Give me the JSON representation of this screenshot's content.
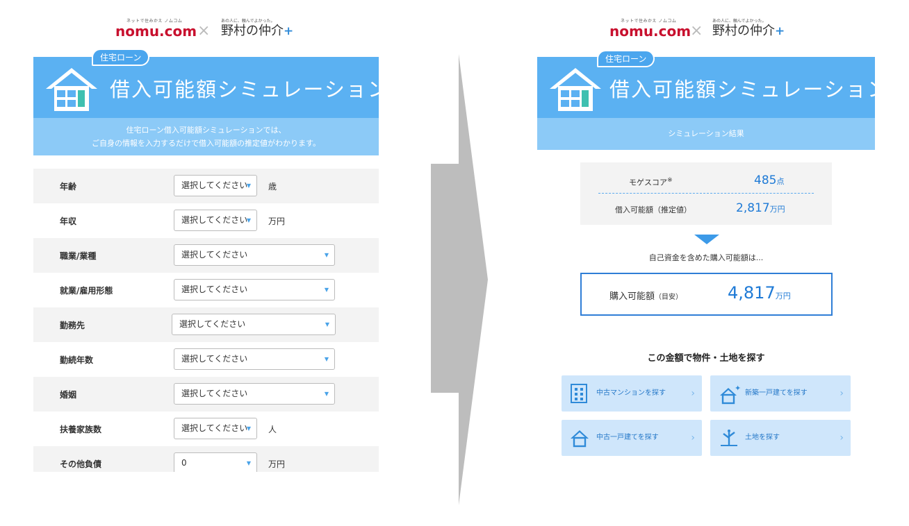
{
  "logos": {
    "nomu_tagline": "ネットで住みかえ ノムコム",
    "nomu_brand": "nomu.com",
    "separator": "×",
    "nakai_tagline": "あの人に、頼んでよかった。",
    "nakai_brand": "野村の仲介",
    "nakai_plus": "+"
  },
  "badge": "住宅ローン",
  "title": "借入可能額シミュレーション",
  "form_screen": {
    "intro_line1": "住宅ローン借入可能額シミュレーションでは、",
    "intro_line2": "ご自身の情報を入力するだけで借入可能額の推定値がわかります。",
    "rows": [
      {
        "label": "年齢",
        "value": "選択してください",
        "unit": "歳"
      },
      {
        "label": "年収",
        "value": "選択してください",
        "unit": "万円"
      },
      {
        "label": "職業/業種",
        "value": "選択してください",
        "unit": ""
      },
      {
        "label": "就業/雇用形態",
        "value": "選択してください",
        "unit": ""
      },
      {
        "label": "勤務先",
        "value": "選択してください",
        "unit": ""
      },
      {
        "label": "勤続年数",
        "value": "選択してください",
        "unit": ""
      },
      {
        "label": "婚姻",
        "value": "選択してください",
        "unit": ""
      },
      {
        "label": "扶養家族数",
        "value": "選択してください",
        "unit": "人"
      },
      {
        "label": "その他負債",
        "value": "0",
        "unit": "万円"
      }
    ]
  },
  "result_screen": {
    "subheading": "シミュレーション結果",
    "moge_label": "モゲスコア",
    "moge_mark": "※",
    "moge_value": "485",
    "moge_unit": "点",
    "loan_label": "借入可能額（推定値）",
    "loan_value": "2,817",
    "loan_unit": "万円",
    "caption": "自己資金を含めた購入可能額は...",
    "purchase_label": "購入可能額",
    "purchase_sub": "（目安）",
    "purchase_value": "4,817",
    "purchase_unit": "万円",
    "search_title": "この金額で物件・土地を探す",
    "buttons": [
      {
        "label": "中古マンションを探す",
        "icon": "building-icon"
      },
      {
        "label": "新築一戸建てを探す",
        "icon": "new-house-icon"
      },
      {
        "label": "中古一戸建てを探す",
        "icon": "house-icon"
      },
      {
        "label": "土地を探す",
        "icon": "sprout-icon"
      }
    ],
    "chevron": "›"
  },
  "colors": {
    "banner": "#5bb1f2",
    "subbar": "#8ccaf7",
    "accent": "#1e7ad6",
    "nomu_red": "#c8102e"
  }
}
